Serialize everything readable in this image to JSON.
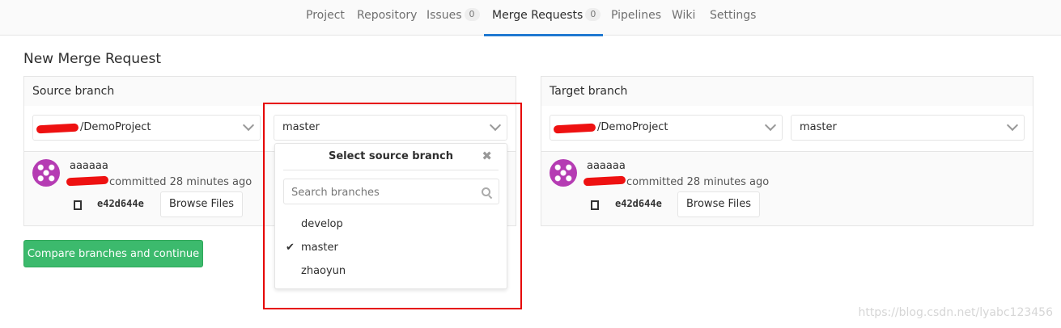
{
  "nav": {
    "tabs": [
      {
        "label": "Project"
      },
      {
        "label": "Repository"
      },
      {
        "label": "Issues",
        "badge": "0"
      },
      {
        "label": "Merge Requests",
        "badge": "0"
      },
      {
        "label": "Pipelines"
      },
      {
        "label": "Wiki"
      },
      {
        "label": "Settings"
      }
    ],
    "active_tab": "Merge Requests",
    "accent_color": "#1f78d1"
  },
  "page": {
    "title": "New Merge Request"
  },
  "source": {
    "header": "Source branch",
    "project_value": "/DemoProject",
    "branch_value": "master",
    "commit": {
      "author": "aaaaaa",
      "committed_text": "committed 28 minutes ago",
      "sha": "e42d644e",
      "browse_label": "Browse Files"
    }
  },
  "target": {
    "header": "Target branch",
    "project_value": "/DemoProject",
    "branch_value": "master",
    "commit": {
      "author": "aaaaaa",
      "committed_text": "committed 28 minutes ago",
      "sha": "e42d644e",
      "browse_label": "Browse Files"
    }
  },
  "dropdown": {
    "title": "Select source branch",
    "close_glyph": "✖",
    "search_placeholder": "Search branches",
    "items": [
      {
        "label": "develop",
        "selected": false
      },
      {
        "label": "master",
        "selected": true
      },
      {
        "label": "zhaoyun",
        "selected": false
      }
    ],
    "check_glyph": "✔"
  },
  "actions": {
    "compare_label": "Compare branches and continue",
    "compare_color": "#3cba6d"
  },
  "annotation": {
    "highlight_color": "#e60000"
  },
  "watermark": "https://blog.csdn.net/lyabc123456"
}
